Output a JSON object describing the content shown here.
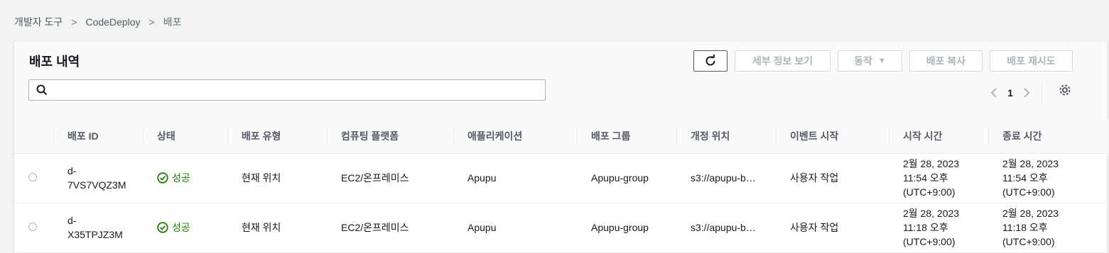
{
  "breadcrumb": {
    "items": [
      "개발자 도구",
      "CodeDeploy"
    ],
    "current": "배포",
    "separator": ">"
  },
  "panel": {
    "title": "배포 내역",
    "buttons": {
      "details": "세부 정보 보기",
      "actions": "동작",
      "copy": "배포 복사",
      "retry": "배포 재시도"
    },
    "search": {
      "value": "",
      "placeholder": ""
    },
    "pager": {
      "page": "1"
    }
  },
  "table": {
    "columns": [
      "배포 ID",
      "상태",
      "배포 유형",
      "컴퓨팅 플랫폼",
      "애플리케이션",
      "배포 그룹",
      "개정 위치",
      "이벤트 시작",
      "시작 시간",
      "종료 시간"
    ],
    "rows": [
      {
        "id_line1": "d-",
        "id_line2": "7VS7VQZ3M",
        "status": "성공",
        "type": "현재 위치",
        "platform": "EC2/온프레미스",
        "application": "Apupu",
        "group": "Apupu-group",
        "revision": "s3://apupu-b…",
        "event": "사용자 작업",
        "start": [
          "2월 28, 2023",
          "11:54 오후",
          "(UTC+9:00)"
        ],
        "end": [
          "2월 28, 2023",
          "11:54 오후",
          "(UTC+9:00)"
        ]
      },
      {
        "id_line1": "d-",
        "id_line2": "X35TPJZ3M",
        "status": "성공",
        "type": "현재 위치",
        "platform": "EC2/온프레미스",
        "application": "Apupu",
        "group": "Apupu-group",
        "revision": "s3://apupu-b…",
        "event": "사용자 작업",
        "start": [
          "2월 28, 2023",
          "11:18 오후",
          "(UTC+9:00)"
        ],
        "end": [
          "2월 28, 2023",
          "11:18 오후",
          "(UTC+9:00)"
        ]
      }
    ]
  },
  "colors": {
    "link": "#0073bb",
    "success": "#1d8102",
    "disabled": "#aab7b8"
  },
  "icons": [
    "refresh-icon",
    "search-icon",
    "chevron-left-icon",
    "chevron-right-icon",
    "gear-icon",
    "success-check-icon",
    "caret-down-icon"
  ]
}
